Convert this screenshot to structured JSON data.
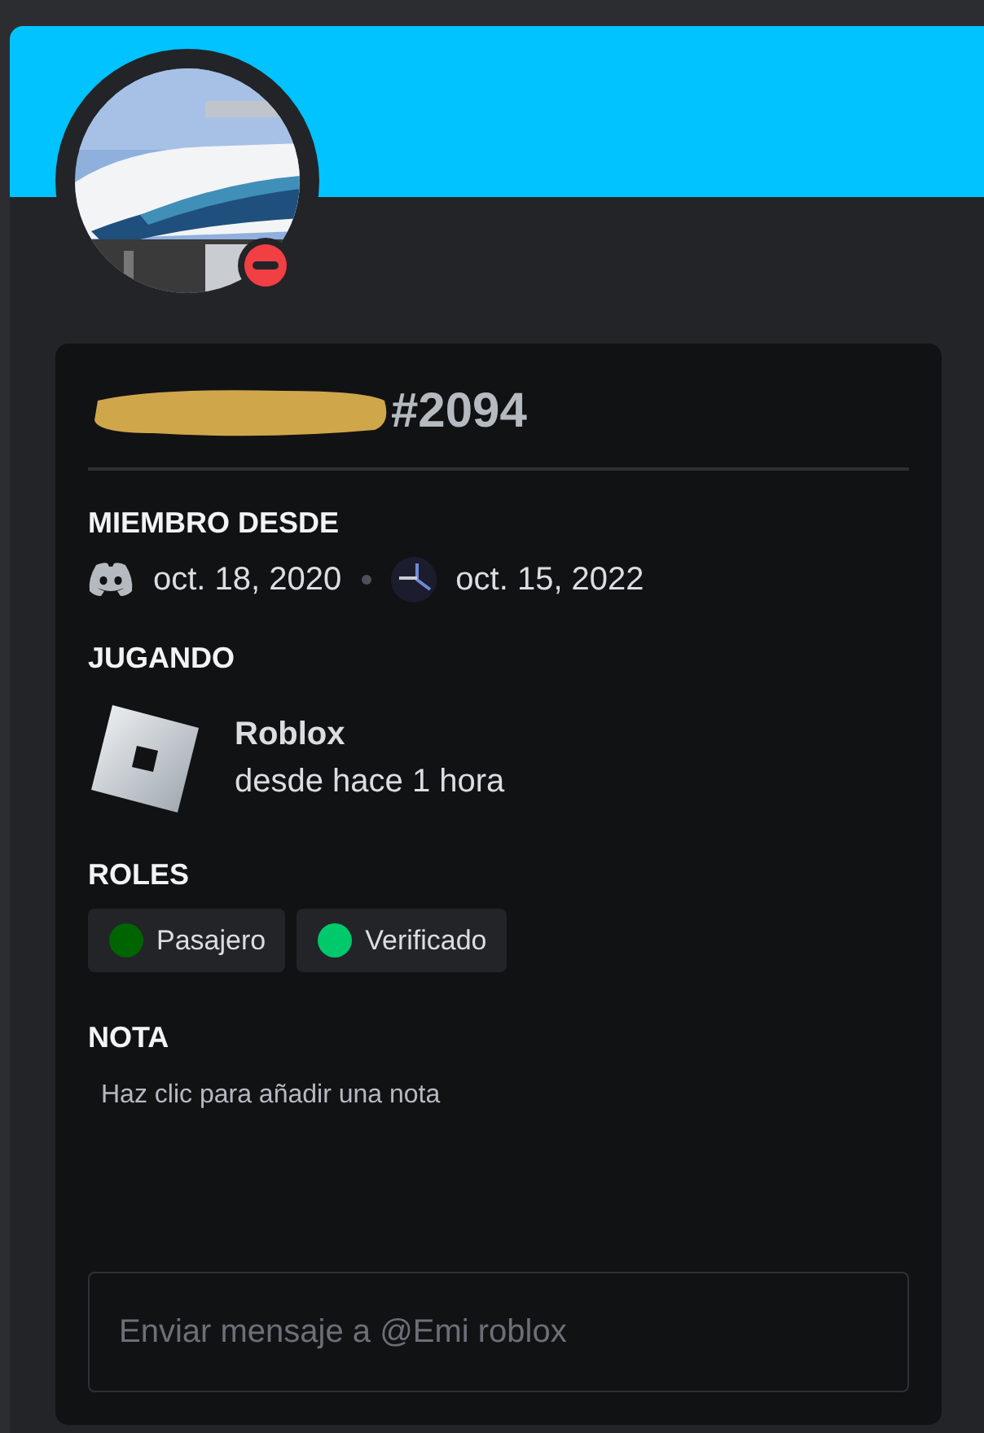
{
  "profile": {
    "do_not_disturb": true,
    "discriminator": "#2094"
  },
  "member_since": {
    "heading": "MIEMBRO DESDE",
    "discord_date": "oct. 18, 2020",
    "server_date": "oct. 15, 2022"
  },
  "playing": {
    "heading": "JUGANDO",
    "game": "Roblox",
    "elapsed": "desde hace 1 hora"
  },
  "roles": {
    "heading": "ROLES",
    "items": [
      {
        "name": "Pasajero",
        "color": "#006400"
      },
      {
        "name": "Verificado",
        "color": "#00c96b"
      }
    ]
  },
  "note": {
    "heading": "NOTA",
    "placeholder": "Haz clic para añadir una nota"
  },
  "message": {
    "placeholder": "Enviar mensaje a @Emi roblox"
  }
}
